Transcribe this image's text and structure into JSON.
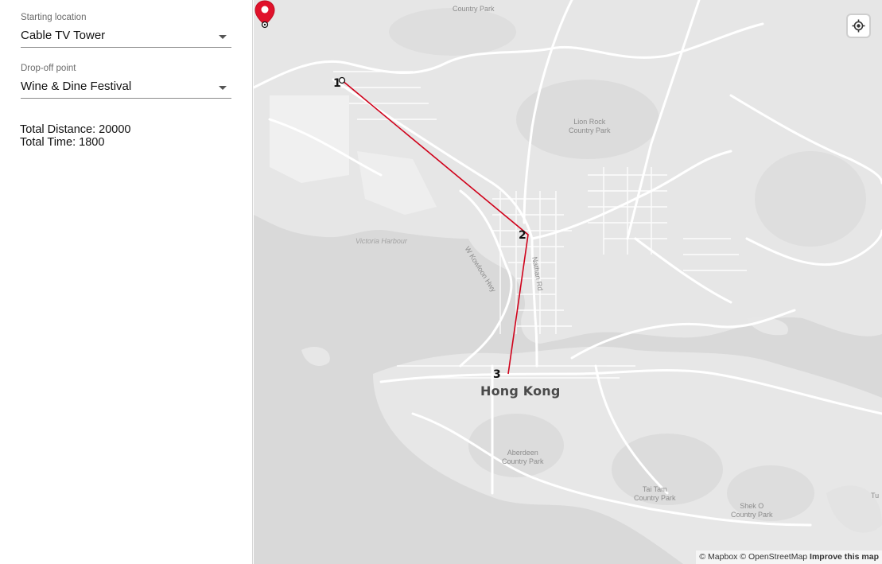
{
  "form": {
    "start": {
      "label": "Starting location",
      "value": "Cable TV Tower"
    },
    "dropoff": {
      "label": "Drop-off point",
      "value": "Wine & Dine Festival"
    }
  },
  "stats": {
    "distance": "Total Distance: 20000",
    "time": "Total Time: 1800"
  },
  "map": {
    "route_color": "#d0021b",
    "labels": {
      "country_park_top": "Country Park",
      "lion_rock": "Lion Rock\nCountry Park",
      "victoria_harbour": "Victoria Harbour",
      "w_kowloon_hwy": "W Kowloon Hwy",
      "nathan_rd": "Nathan Rd",
      "hong_kong": "Hong Kong",
      "aberdeen": "Aberdeen\nCountry Park",
      "tai_tam": "Tai Tam\nCountry Park",
      "shek_o": "Shek O\nCountry Park",
      "tu": "Tu"
    },
    "waypoints": [
      "1",
      "2",
      "3"
    ],
    "attribution": {
      "mapbox": "© Mapbox",
      "osm": "© OpenStreetMap",
      "improve": "Improve this map"
    },
    "icons": {
      "locate": "locate-icon",
      "pin": "map-pin-icon"
    }
  }
}
